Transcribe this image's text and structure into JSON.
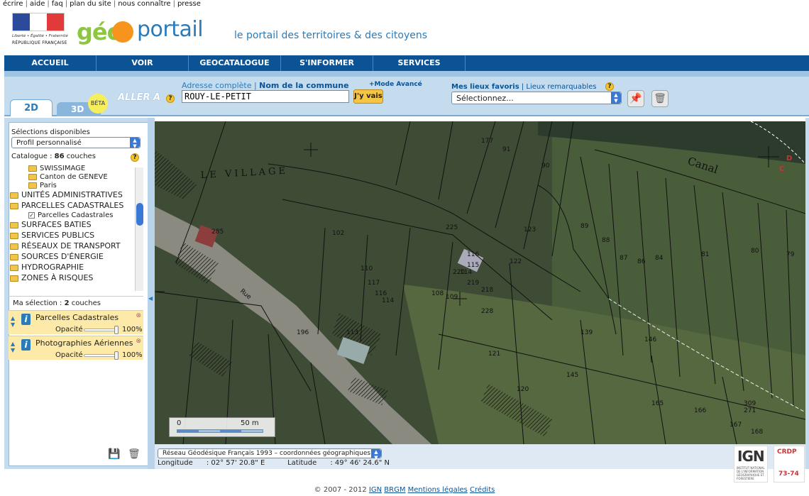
{
  "top_links": [
    "écrire",
    "aide",
    "faq",
    "plan du site",
    "nous connaître",
    "presse"
  ],
  "republique": {
    "motto": "Liberté • Égalité • Fraternité",
    "name": "RÉPUBLIQUE FRANÇAISE"
  },
  "logo": {
    "geo": "géo",
    "portail": "portail"
  },
  "tagline": "le portail des territoires & des citoyens",
  "nav": [
    "ACCUEIL",
    "VOIR",
    "GEOCATALOGUE",
    "S'INFORMER",
    "SERVICES"
  ],
  "tabs": {
    "tab_2d": "2D",
    "tab_3d": "3D",
    "beta": "BÉTA"
  },
  "search": {
    "aller_a": "ALLER À",
    "adresse_label": "Adresse complète",
    "commune_label": "Nom de la commune",
    "mode_avance": "+Mode Avancé",
    "value": "ROUY-LE-PETIT",
    "go_label": "J'y vais"
  },
  "favorites": {
    "mes_lieux": "Mes lieux favoris",
    "lieux_remarquables": "Lieux remarquables",
    "selected": "Sélectionnez..."
  },
  "sidebar": {
    "selections_title": "Sélections disponibles",
    "profile_selected": "Profil personnalisé",
    "catalogue_label": "Catalogue :",
    "catalogue_count": "86",
    "catalogue_unit": "couches",
    "layer_list": [
      {
        "type": "sub",
        "label": "SWISSIMAGE"
      },
      {
        "type": "sub",
        "label": "Canton de GENEVE"
      },
      {
        "type": "sub",
        "label": "Paris"
      },
      {
        "type": "folder",
        "label": "UNITÉS ADMINISTRATIVES"
      },
      {
        "type": "folder",
        "label": "PARCELLES CADASTRALES"
      },
      {
        "type": "checked",
        "label": "Parcelles Cadastrales"
      },
      {
        "type": "folder",
        "label": "SURFACES BATIES"
      },
      {
        "type": "folder",
        "label": "SERVICES PUBLICS"
      },
      {
        "type": "folder",
        "label": "RÉSEAUX DE TRANSPORT"
      },
      {
        "type": "folder",
        "label": "SOURCES D'ÉNERGIE"
      },
      {
        "type": "folder",
        "label": "HYDROGRAPHIE"
      },
      {
        "type": "folder",
        "label": "ZONES À RISQUES"
      }
    ],
    "my_selection_label": "Ma sélection :",
    "my_selection_count": "2",
    "my_selection_unit": "couches",
    "selected_layers": [
      {
        "name": "Parcelles Cadastrales",
        "opacity_label": "Opacité",
        "opacity": "100%"
      },
      {
        "name": "Photographies Aériennes",
        "opacity_label": "Opacité",
        "opacity": "100%"
      }
    ]
  },
  "map": {
    "place_label": "LE VILLAGE",
    "canal_label": "Canal",
    "street_label": "Rue",
    "parcels": [
      "177",
      "91",
      "90",
      "89",
      "88",
      "87",
      "86",
      "84",
      "81",
      "80",
      "79",
      "123",
      "122",
      "116",
      "115",
      "114",
      "109",
      "108",
      "102",
      "225",
      "220",
      "219",
      "218",
      "110",
      "117",
      "116",
      "114",
      "113",
      "196",
      "121",
      "120",
      "139",
      "145",
      "146",
      "165",
      "166",
      "167",
      "168",
      "285",
      "309",
      "228",
      "271"
    ],
    "scale": {
      "zero": "0",
      "distance": "50 m"
    }
  },
  "bottom": {
    "projection": "Réseau Géodésique Français 1993 – coordonnées géographiques",
    "longitude_label": "Longitude",
    "longitude_value": ": 02° 57' 20.8\" E",
    "latitude_label": "Latitude",
    "latitude_value": ": 49° 46' 24.6\" N",
    "ign": "IGN",
    "ign_text": "INSTITUT NATIONAL DE L'INFORMATION GÉOGRAPHIQUE ET FORESTIÈRE",
    "crdp_letters": "CRDP",
    "crdp_num": "73-74"
  },
  "footer": {
    "copyright": "© 2007 - 2012",
    "links": [
      "IGN",
      "BRGM",
      "Mentions légales",
      "Crédits"
    ]
  }
}
